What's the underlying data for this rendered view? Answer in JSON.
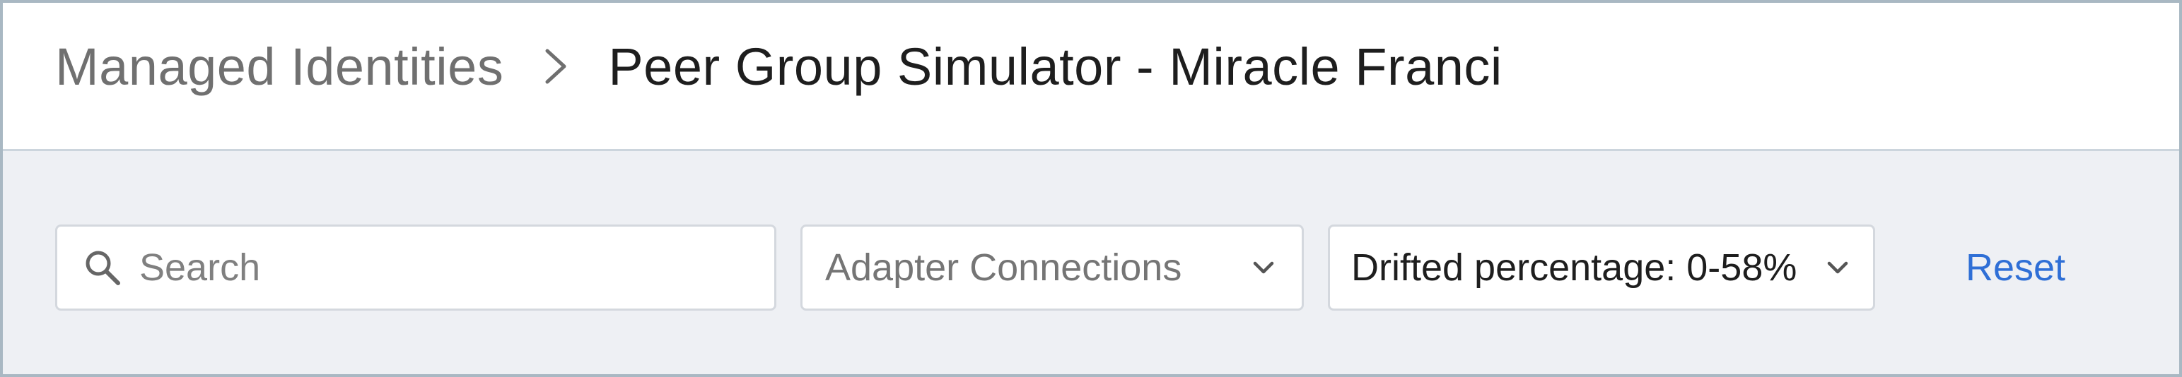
{
  "breadcrumb": {
    "parent": "Managed Identities",
    "separator_icon": "chevron-right-icon",
    "current": "Peer Group Simulator - Miracle Franci"
  },
  "filters": {
    "search": {
      "placeholder": "Search",
      "value": "",
      "icon": "search-icon"
    },
    "adapter_connections": {
      "label": "Adapter Connections",
      "icon": "chevron-down-icon"
    },
    "drifted_percentage": {
      "label": "Drifted percentage: 0-58%",
      "icon": "chevron-down-icon"
    },
    "reset_label": "Reset"
  },
  "colors": {
    "link": "#2f6fd6",
    "toolbar_bg": "#eef0f4",
    "header_bg": "#ffffff",
    "frame_border": "#a9b8c3"
  }
}
